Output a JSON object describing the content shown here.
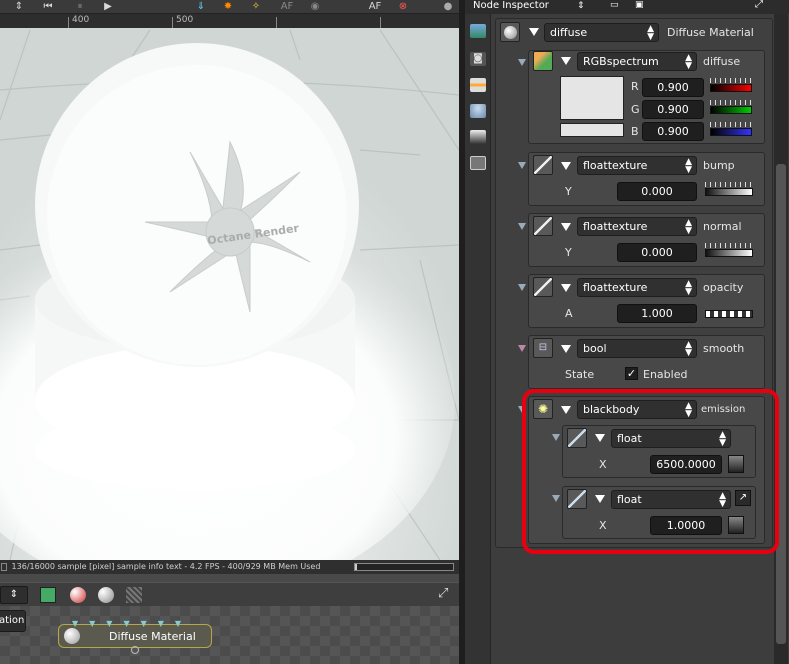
{
  "viewport": {
    "render_watermark": "Octane Render",
    "ruler_marks": [
      "400",
      "500"
    ],
    "toolbar": [
      "⏮",
      "⏸",
      "▶",
      "AF",
      "AF"
    ],
    "status_text": "136/16000 sample [pixel] sample info text - 4.2 FPS - 400/929 MB Mem Used",
    "status_progress": "136/16000"
  },
  "nodegraph": {
    "left_button": "ation",
    "node_label": "Diffuse Material"
  },
  "inspector": {
    "title": "Node Inspector",
    "material": {
      "type": "diffuse",
      "name": "Diffuse Material"
    },
    "diffuse": {
      "type": "RGBspectrum",
      "name": "diffuse",
      "channels": [
        {
          "label": "R",
          "value": "0.900"
        },
        {
          "label": "G",
          "value": "0.900"
        },
        {
          "label": "B",
          "value": "0.900"
        }
      ]
    },
    "bump": {
      "type": "floattexture",
      "name": "bump",
      "label": "Y",
      "value": "0.000"
    },
    "normal": {
      "type": "floattexture",
      "name": "normal",
      "label": "Y",
      "value": "0.000"
    },
    "opacity": {
      "type": "floattexture",
      "name": "opacity",
      "label": "A",
      "value": "1.000"
    },
    "smooth": {
      "type": "bool",
      "name": "smooth",
      "label": "State",
      "check_label": "Enabled",
      "checked": true
    },
    "emission": {
      "type": "blackbody",
      "name": "emission",
      "temperature": {
        "type": "float",
        "label": "X",
        "value": "6500.0000"
      },
      "power": {
        "type": "float",
        "label": "X",
        "value": "1.0000"
      }
    }
  },
  "colors": {
    "highlight": "#e8000f",
    "panel": "#484848",
    "field": "#1f1f1f"
  }
}
